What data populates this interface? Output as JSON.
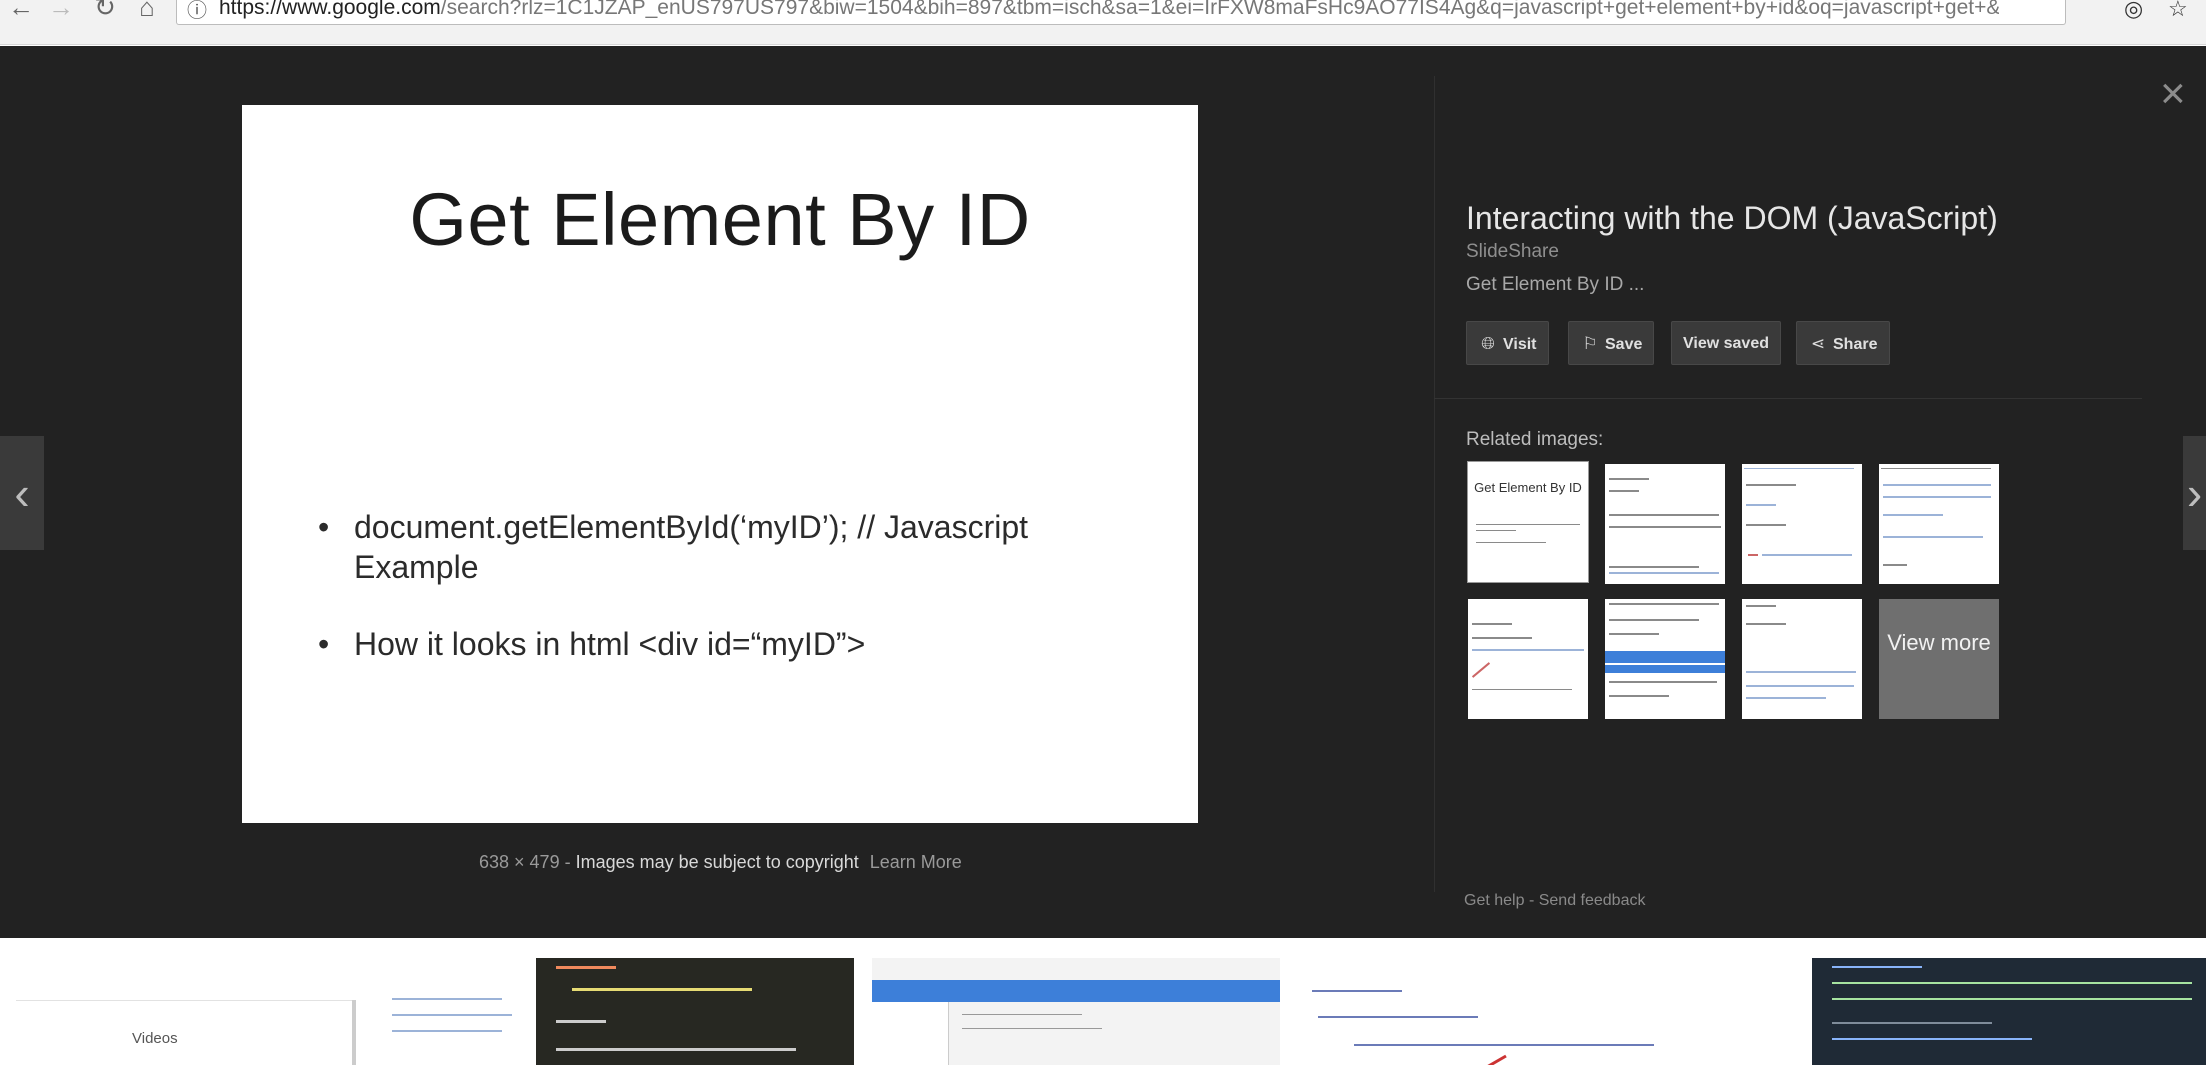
{
  "browser": {
    "url_host": "https://www.google.com",
    "url_path": "/search?rlz=1C1JZAP_enUS797US797&biw=1504&bih=897&tbm=isch&sa=1&ei=IrFXW8maFsHc9AO77IS4Ag&q=javascript+get+element+by+id&oq=javascript+get+&gs_l=im..."
  },
  "viewer": {
    "slide": {
      "title": "Get Element By ID",
      "bullets": [
        "document.getElementById(‘myID’); // Javascript Example",
        "How it looks in html <div id=“myID”>"
      ]
    },
    "meta": {
      "dimensions": "638 × 479",
      "separator": "-",
      "copyright": "Images may be subject to copyright",
      "learn_more": "Learn More"
    },
    "close_icon": "×",
    "prev_icon": "‹",
    "next_icon": "›"
  },
  "result": {
    "title": "Interacting with the DOM (JavaScript)",
    "source": "SlideShare",
    "description": "Get Element By ID ...",
    "actions": [
      {
        "label": "Visit",
        "icon": "globe-icon"
      },
      {
        "label": "Save",
        "icon": "bookmark-icon"
      },
      {
        "label": "View saved",
        "icon": ""
      },
      {
        "label": "Share",
        "icon": "share-icon"
      }
    ]
  },
  "related": {
    "label": "Related images:",
    "first_thumb_title": "Get Element By ID",
    "view_more": "View more"
  },
  "footer_links": {
    "help": "Get help",
    "separator": "-",
    "feedback": "Send feedback"
  },
  "strip": {
    "videos_label": "Videos"
  }
}
